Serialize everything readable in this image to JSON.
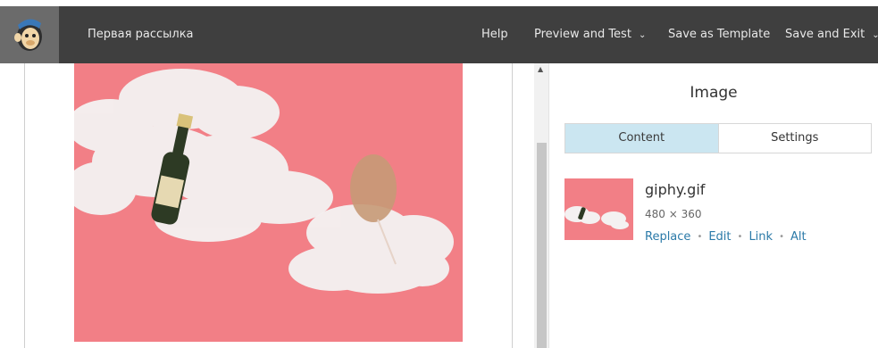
{
  "header": {
    "campaign_title": "Первая рассылка",
    "nav": {
      "help": "Help",
      "preview_and_test": "Preview and Test",
      "save_as_template": "Save as Template",
      "save_and_exit": "Save and Exit"
    },
    "chevron_glyph": "❯"
  },
  "colors": {
    "topbar": "#3f3f3f",
    "logo_bg": "#6b6b6b",
    "hero_bg": "#f27f86",
    "tab_active": "#cbe6f1",
    "link": "#2b7aa8"
  },
  "panel": {
    "title": "Image",
    "tabs": [
      {
        "label": "Content",
        "active": true
      },
      {
        "label": "Settings",
        "active": false
      }
    ],
    "file": {
      "name": "giphy.gif",
      "dimensions": "480 × 360",
      "actions": [
        "Replace",
        "Edit",
        "Link",
        "Alt"
      ],
      "separator": "•"
    }
  },
  "icons": {
    "logo": "mailchimp-freddie-icon",
    "scroll_up": "▲"
  }
}
